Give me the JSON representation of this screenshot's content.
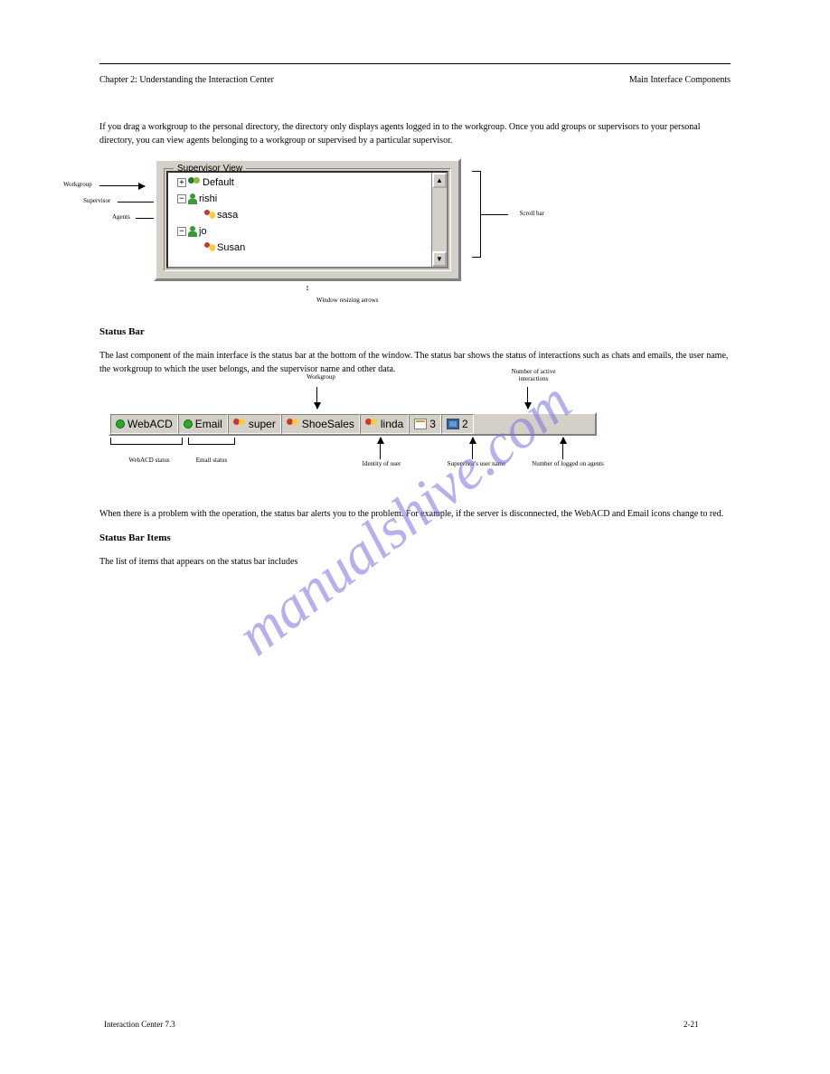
{
  "header": {
    "left": "Chapter 2: Understanding the Interaction Center",
    "right": "Main Interface Components"
  },
  "intro_para": "If you drag a workgroup to the personal directory, the directory only displays agents logged in to the workgroup. Once you add groups or supervisors to your personal directory, you can view agents belonging to a workgroup or supervised by a particular supervisor.",
  "supervisor_view": {
    "title": "Supervisor View",
    "items": [
      {
        "label": "Default",
        "level": 0,
        "icon": "people",
        "expander": "plus"
      },
      {
        "label": "rishi",
        "level": 1,
        "icon": "person-green",
        "expander": "minus"
      },
      {
        "label": "sasa",
        "level": 2,
        "icon": "person-umbrella",
        "expander": ""
      },
      {
        "label": "jo",
        "level": 1,
        "icon": "person-green",
        "expander": "minus"
      },
      {
        "label": "Susan",
        "level": 2,
        "icon": "person-umbrella",
        "expander": ""
      }
    ]
  },
  "panel_labels": {
    "workgroup": "Workgroup",
    "supervisor": "Supervisor",
    "agent": "Agents",
    "scroll": "Scroll bar",
    "resizing": "Window resizing arrows"
  },
  "section2_title": "Status Bar",
  "section2_para": "The last component of the main interface is the status bar at the bottom of the window. The status bar shows the status of interactions such as chats and emails, the user name, the workgroup to which the user belongs, and the supervisor name and other data.",
  "statusbar": {
    "cells": [
      {
        "icon": "dot-green",
        "label": "WebACD"
      },
      {
        "icon": "dot-green",
        "label": "Email"
      },
      {
        "icon": "person-group-red",
        "label": "super"
      },
      {
        "icon": "person-group-red",
        "label": "ShoeSales"
      },
      {
        "icon": "person-group-red",
        "label": "linda"
      },
      {
        "icon": "card",
        "label": "3"
      },
      {
        "icon": "card-blue",
        "label": "2"
      }
    ]
  },
  "statusbar_labels": {
    "top_left": "Workgroup",
    "top_right": "Number of active interactions",
    "bot_webacd": "WebACD status",
    "bot_email": "Email status",
    "bot_user": "Identity of user",
    "bot_super": "Supervisor's user name",
    "bot_logged": "Number of logged on agents"
  },
  "note": "When there is a problem with the operation, the status bar alerts you to the problem. For example, if the server is disconnected, the WebACD and Email icons change to red.",
  "items_heading": "Status Bar Items",
  "items_para": "The list of items that appears on the status bar includes",
  "footer_left": "Interaction Center 7.3",
  "footer_right": "2-21",
  "watermark": "manualshive.com"
}
